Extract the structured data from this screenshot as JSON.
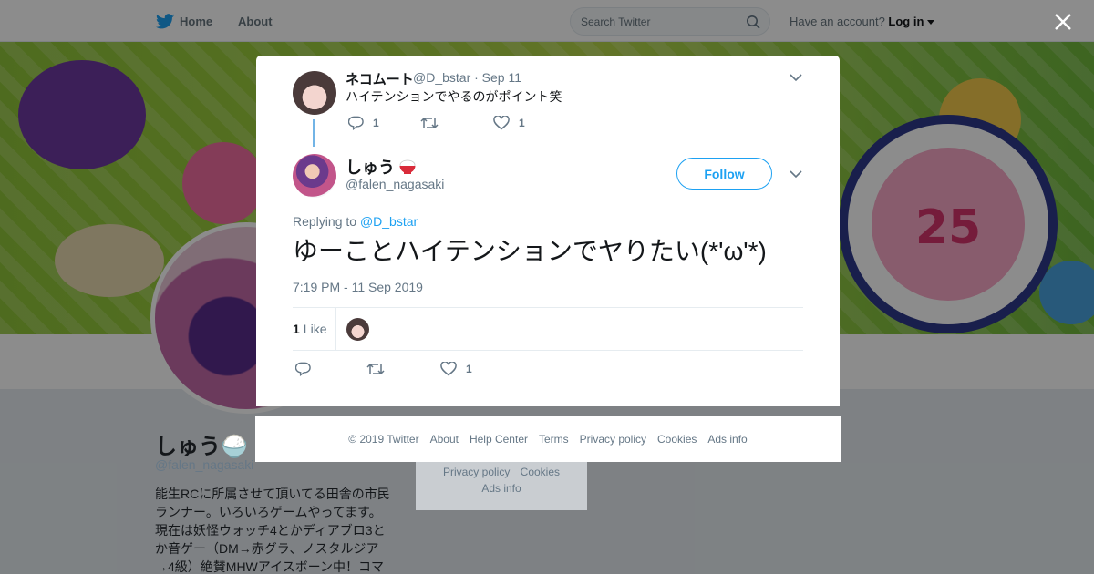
{
  "topbar": {
    "home_label": "Home",
    "about_label": "About",
    "search_placeholder": "Search Twitter",
    "have_account": "Have an account?",
    "login_label": "Log in"
  },
  "background_profile": {
    "name": "しゅう🍚",
    "handle": "@falen_nagasaki",
    "bio": "能生RCに所属させて頂いてる田舎の市民ランナー。いろいろゲームやってます。現在は妖怪ウォッチ4とかディアブロ3とか音ゲー（DM→赤グラ、ノスタルジア→4級）絶賛MHWアイスボーン中！コマ",
    "banner_number": "25",
    "footer_links": [
      "Privacy policy",
      "Cookies",
      "Ads info"
    ]
  },
  "parent_tweet": {
    "name": "ネコムート",
    "handle": "@D_bstar",
    "date": "· Sep 11",
    "text": "ハイテンションでやるのがポイント笑",
    "reply_count": "1",
    "like_count": "1"
  },
  "main_tweet": {
    "name": "しゅう",
    "name_emoji": "rice-bowl-icon",
    "handle": "@falen_nagasaki",
    "follow_label": "Follow",
    "replying_prefix": "Replying to",
    "replying_to": "@D_bstar",
    "text": "ゆーことハイテンションでヤりたい(*'ω'*)",
    "timestamp": "7:19 PM - 11 Sep 2019",
    "likes_number": "1",
    "likes_label": "Like",
    "like_count": "1"
  },
  "modal_footer": {
    "links": [
      "© 2019 Twitter",
      "About",
      "Help Center",
      "Terms",
      "Privacy policy",
      "Cookies",
      "Ads info"
    ]
  },
  "colors": {
    "accent": "#1da1f2",
    "thread_line": "#72b4e6",
    "muted_text": "#657786"
  }
}
